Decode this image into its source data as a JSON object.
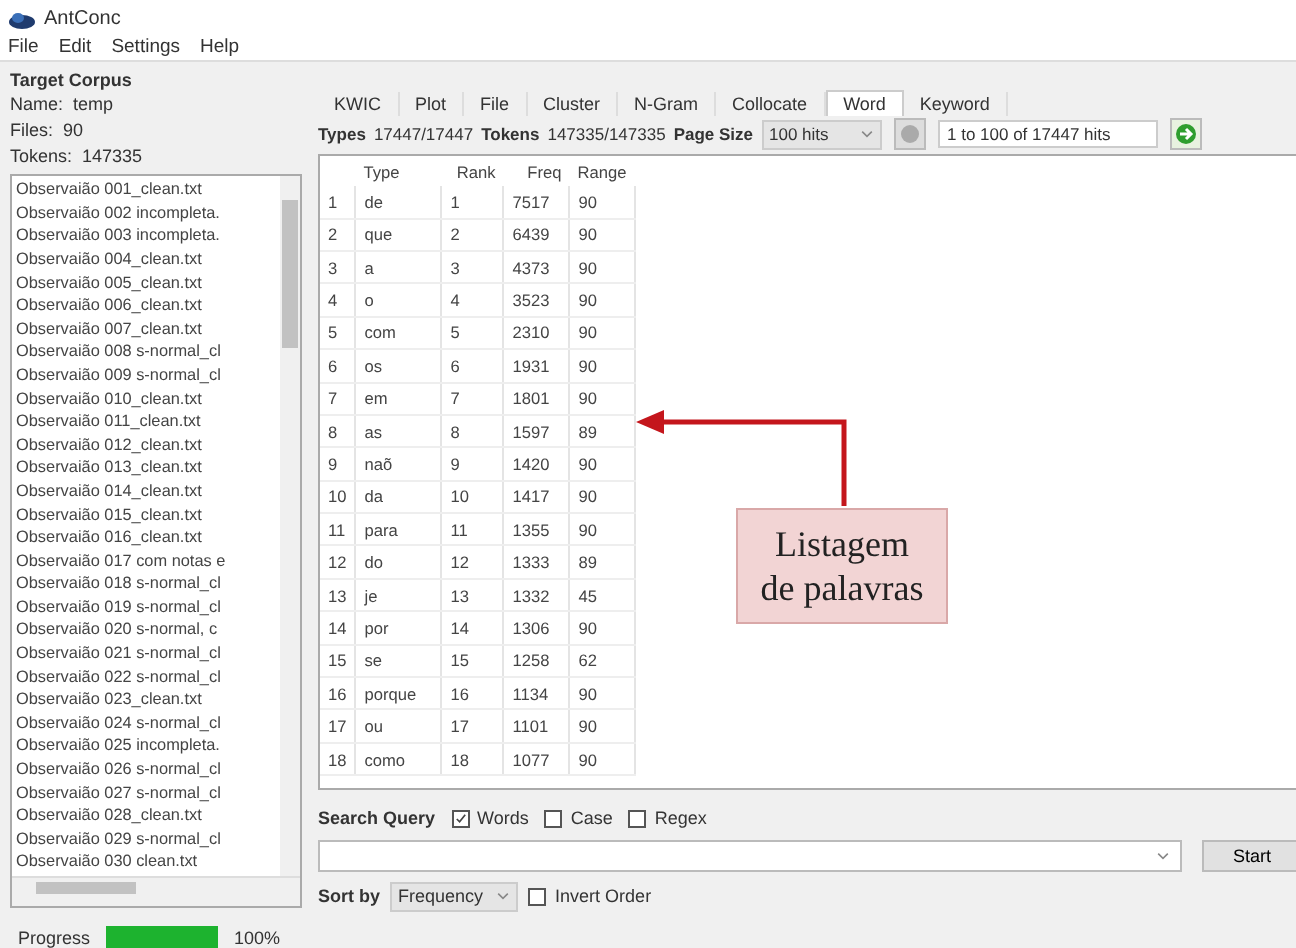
{
  "window": {
    "title": "AntConc"
  },
  "menu": [
    "File",
    "Edit",
    "Settings",
    "Help"
  ],
  "corpus": {
    "heading": "Target Corpus",
    "name_label": "Name:",
    "name": "temp",
    "files_label": "Files:",
    "files": "90",
    "tokens_label": "Tokens:",
    "tokens": "147335",
    "files_list": [
      "Observaião 001_clean.txt",
      "Observaião 002 incompleta.",
      "Observaião 003 incompleta.",
      "Observaião 004_clean.txt",
      "Observaião 005_clean.txt",
      "Observaião 006_clean.txt",
      "Observaião 007_clean.txt",
      "Observaião 008 s-normal_cl",
      "Observaião 009 s-normal_cl",
      "Observaião 010_clean.txt",
      "Observaião 011_clean.txt",
      "Observaião 012_clean.txt",
      "Observaião 013_clean.txt",
      "Observaião 014_clean.txt",
      "Observaião 015_clean.txt",
      "Observaião 016_clean.txt",
      "Observaião 017 com notas e",
      "Observaião 018 s-normal_cl",
      "Observaião 019 s-normal_cl",
      "Observaião 020 s-normal, c",
      "Observaião 021 s-normal_cl",
      "Observaião 022 s-normal_cl",
      "Observaião 023_clean.txt",
      "Observaião 024 s-normal_cl",
      "Observaião 025 incompleta.",
      "Observaião 026 s-normal_cl",
      "Observaião 027 s-normal_cl",
      "Observaião 028_clean.txt",
      "Observaião 029 s-normal_cl",
      "Observaião 030 clean.txt"
    ]
  },
  "progress": {
    "label": "Progress",
    "level": 1,
    "reading": "100%"
  },
  "tabs": [
    {
      "label": "KWIC",
      "selected": false
    },
    {
      "label": "Plot",
      "selected": false
    },
    {
      "label": "File",
      "selected": false
    },
    {
      "label": "Cluster",
      "selected": false
    },
    {
      "label": "N-Gram",
      "selected": false
    },
    {
      "label": "Collocate",
      "selected": false
    },
    {
      "label": "Word",
      "selected": true
    },
    {
      "label": "Keyword",
      "selected": false
    }
  ],
  "stats": {
    "types_label": "Types",
    "types": "17447/17447",
    "tokens_label": "Tokens",
    "tokens": "147335/147335",
    "page_size_label": "Page Size",
    "page_size": "100 hits",
    "hits": "1 to 100 of 17447 hits"
  },
  "table": {
    "columns": [
      "",
      "Type",
      "Rank",
      "Freq",
      "Range"
    ],
    "rows": [
      [
        "1",
        "de",
        "1",
        "7517",
        "90"
      ],
      [
        "2",
        "que",
        "2",
        "6439",
        "90"
      ],
      [
        "3",
        "a",
        "3",
        "4373",
        "90"
      ],
      [
        "4",
        "o",
        "4",
        "3523",
        "90"
      ],
      [
        "5",
        "com",
        "5",
        "2310",
        "90"
      ],
      [
        "6",
        "os",
        "6",
        "1931",
        "90"
      ],
      [
        "7",
        "em",
        "7",
        "1801",
        "90"
      ],
      [
        "8",
        "as",
        "8",
        "1597",
        "89"
      ],
      [
        "9",
        "naõ",
        "9",
        "1420",
        "90"
      ],
      [
        "10",
        "da",
        "10",
        "1417",
        "90"
      ],
      [
        "11",
        "para",
        "11",
        "1355",
        "90"
      ],
      [
        "12",
        "do",
        "12",
        "1333",
        "89"
      ],
      [
        "13",
        "je",
        "13",
        "1332",
        "45"
      ],
      [
        "14",
        "por",
        "14",
        "1306",
        "90"
      ],
      [
        "15",
        "se",
        "15",
        "1258",
        "62"
      ],
      [
        "16",
        "porque",
        "16",
        "1134",
        "90"
      ],
      [
        "17",
        "ou",
        "17",
        "1101",
        "90"
      ],
      [
        "18",
        "como",
        "18",
        "1077",
        "90"
      ]
    ]
  },
  "annotation": {
    "text": "Listagem de palavras"
  },
  "search": {
    "label": "Search Query",
    "options": [
      {
        "label": "Words",
        "checked": true
      },
      {
        "label": "Case",
        "checked": false
      },
      {
        "label": "Regex",
        "checked": false
      }
    ],
    "button": "Start"
  },
  "sort": {
    "label": "Sort by",
    "value": "Frequency",
    "invert": {
      "label": "Invert Order",
      "checked": false
    }
  }
}
